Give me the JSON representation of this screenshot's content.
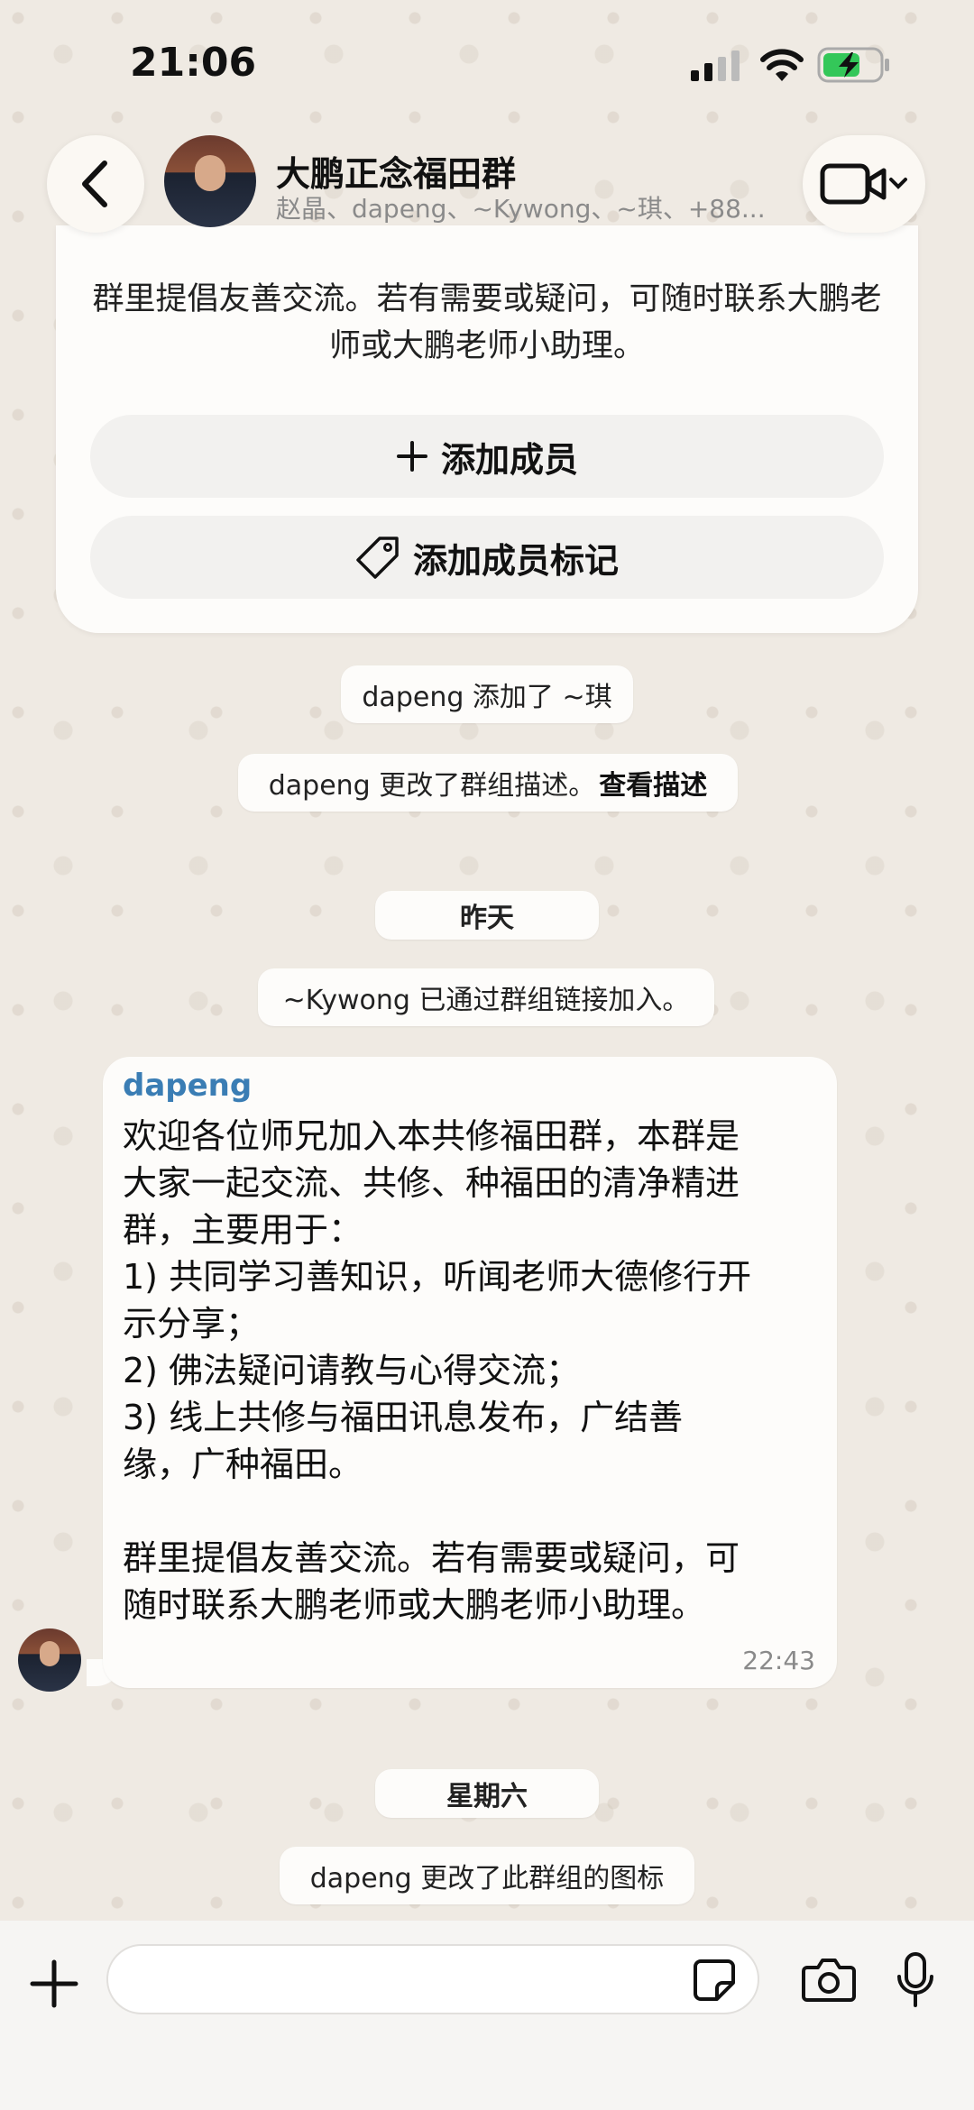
{
  "status_bar": {
    "time": "21:06"
  },
  "header": {
    "title": "大鹏正念福田群",
    "members": "赵晶、dapeng、~Kywong、~琪、+88..."
  },
  "info_card": {
    "description": "群里提倡友善交流。若有需要或疑问，可随时联系大鹏老师或大鹏老师小助理。",
    "add_member_label": "添加成员",
    "add_member_tag_label": "添加成员标记"
  },
  "events": {
    "added": "dapeng 添加了 ~琪",
    "desc_changed": "dapeng 更改了群组描述。",
    "view_desc": "查看描述",
    "day_yesterday": "昨天",
    "joined_via_link": "~Kywong 已通过群组链接加入。",
    "day_saturday": "星期六",
    "icon_changed": "dapeng 更改了此群组的图标"
  },
  "message": {
    "sender": "dapeng",
    "text": "欢迎各位师兄加入本共修福田群，本群是\n大家一起交流、共修、种福田的清净精进\n群，主要用于：\n1) 共同学习善知识，听闻老师大德修行开\n示分享；\n2) 佛法疑问请教与心得交流；\n3) 线上共修与福田讯息发布，广结善\n缘，广种福田。\n\n群里提倡友善交流。若有需要或疑问，可\n随时联系大鹏老师或大鹏老师小助理。",
    "time": "22:43"
  },
  "composer": {
    "placeholder": ""
  },
  "colors": {
    "sender_name": "#3a7db4",
    "battery_fill": "#34c759",
    "wallpaper": "#efeae3"
  }
}
